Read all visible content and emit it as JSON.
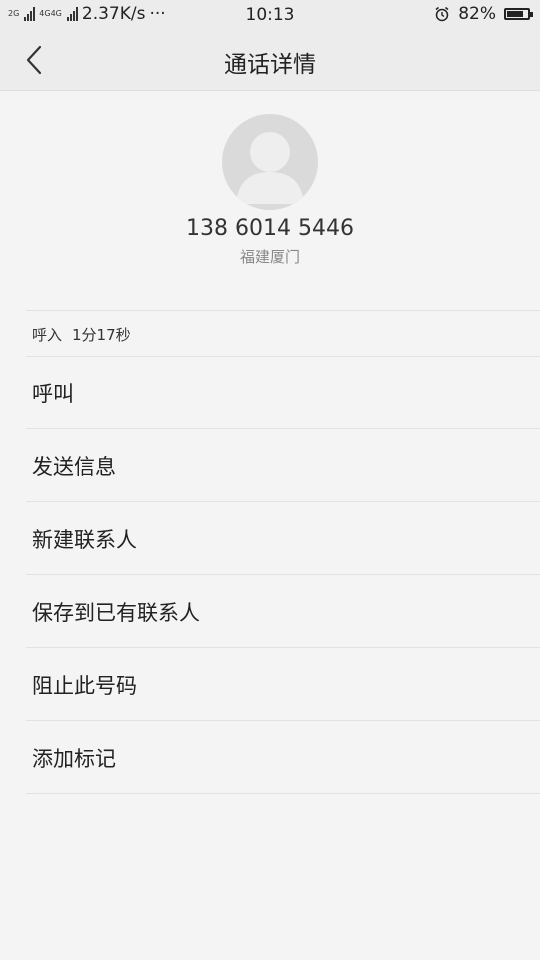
{
  "status_bar": {
    "net_2g": "2G",
    "net_4g": "4G4G",
    "speed": "2.37K/s",
    "more": "···",
    "time": "10:13",
    "battery_text": "82%",
    "battery_level": 0.82
  },
  "header": {
    "title": "通话详情"
  },
  "contact": {
    "number": "138 6014 5446",
    "location": "福建厦门"
  },
  "call_info": {
    "direction": "呼入",
    "duration": "1分17秒"
  },
  "actions": [
    {
      "label": "呼叫"
    },
    {
      "label": "发送信息"
    },
    {
      "label": "新建联系人"
    },
    {
      "label": "保存到已有联系人"
    },
    {
      "label": "阻止此号码"
    },
    {
      "label": "添加标记"
    }
  ]
}
